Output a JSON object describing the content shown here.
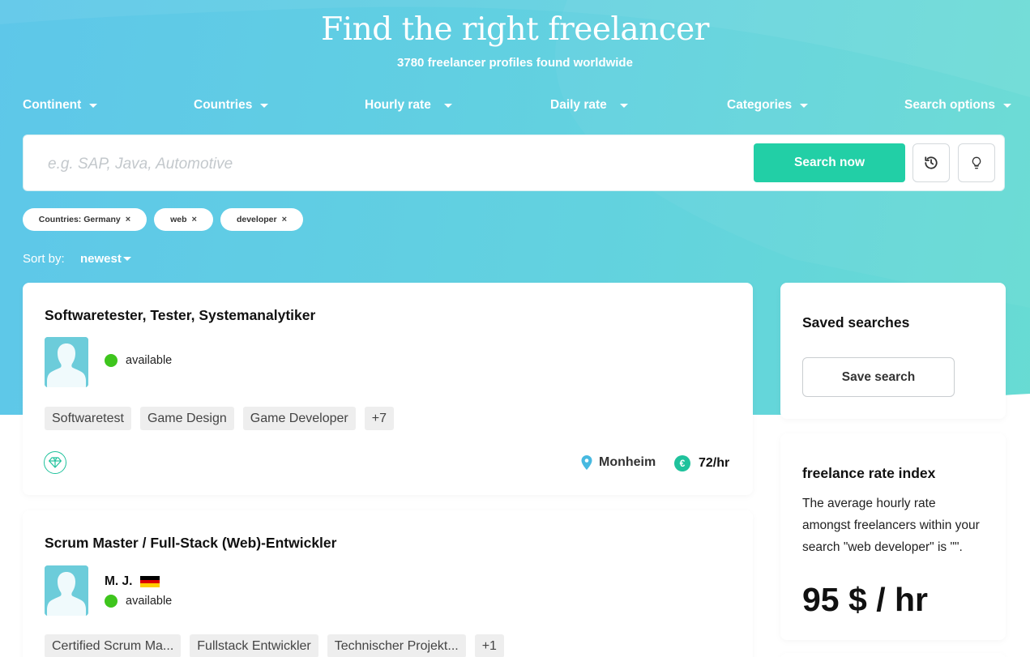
{
  "header": {
    "title": "Find the right freelancer",
    "subtitle": "3780 freelancer profiles found worldwide"
  },
  "filters": [
    "Continent",
    "Countries",
    "Hourly rate",
    "Daily rate",
    "Categories",
    "Search options"
  ],
  "search": {
    "placeholder": "e.g. SAP, Java, Automotive",
    "button_label": "Search now",
    "history_icon": "history-icon",
    "tips_icon": "lightbulb-icon"
  },
  "active_filters": [
    "Countries: Germany",
    "web",
    "developer"
  ],
  "chip_remove_symbol": "×",
  "sort": {
    "label": "Sort by:",
    "value": "newest"
  },
  "results": [
    {
      "title": "Softwaretester, Tester, Systemanalytiker",
      "status": "available",
      "tags": [
        "Softwaretest",
        "Game Design",
        "Game Developer",
        "+7"
      ],
      "location": "Monheim",
      "rate": "72/hr",
      "badge_icon": "diamond-icon"
    },
    {
      "title": "Scrum Master / Full-Stack (Web)-Entwickler",
      "name": "M. J.",
      "country_flag": "germany-flag",
      "status": "available",
      "tags": [
        "Certified Scrum Ma...",
        "Fullstack Entwickler",
        "Technischer Projekt...",
        "+1"
      ]
    }
  ],
  "saved_searches": {
    "title": "Saved searches",
    "button_label": "Save search"
  },
  "rate_index": {
    "title": "freelance rate index",
    "text": "The average hourly rate amongst freelancers within your search \"web developer\" is \"\".",
    "value": "95 $ / hr"
  },
  "colors": {
    "accent": "#22cfa6",
    "available": "#3ec51d",
    "hero_start": "#5ec7e9",
    "hero_end": "#68dcd2"
  }
}
